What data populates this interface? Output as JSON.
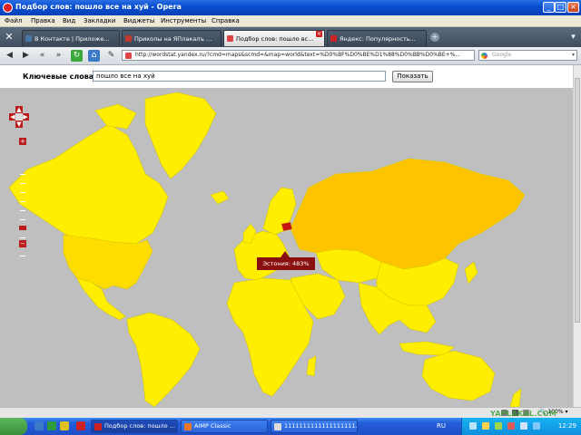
{
  "window": {
    "title": "Подбор слов: пошло все на хуй - Opera"
  },
  "menu": [
    "Файл",
    "Правка",
    "Вид",
    "Закладки",
    "Виджеты",
    "Инструменты",
    "Справка"
  ],
  "tabs": [
    {
      "label": "В Контакте | Приложе...",
      "active": false
    },
    {
      "label": "Приколы на ЯПлакалъ ...",
      "active": false
    },
    {
      "label": "Подбор слов: пошло вс...",
      "active": true
    },
    {
      "label": "Яндекс: Популярность...",
      "active": false
    }
  ],
  "address": {
    "url": "http://wordstat.yandex.ru/?cmd=maps&scmd=&map=world&text=%D0%BF%D0%BE%D1%88%D0%BB%D0%BE+%...",
    "search_placeholder": "Google"
  },
  "form": {
    "label": "Ключевые слова:",
    "value": "пошло все на хуй",
    "button": "Показать"
  },
  "map": {
    "tooltip": "Эстония: 483%",
    "colors": {
      "ocean": "#bfbfbf",
      "low": "#ffee00",
      "mid": "#ffdd00",
      "high": "#ffc400",
      "max": "#8a1010"
    }
  },
  "status": {
    "zoom": "100%",
    "watermark": "YAPLAKAL.COM"
  },
  "taskbar": {
    "tasks": [
      {
        "label": "Подбор слов: пошло ...",
        "active": true
      },
      {
        "label": "AIMP Classic",
        "active": false
      },
      {
        "label": "1111111111111111111...",
        "active": false
      }
    ],
    "lang": "RU",
    "clock": "12:29"
  }
}
